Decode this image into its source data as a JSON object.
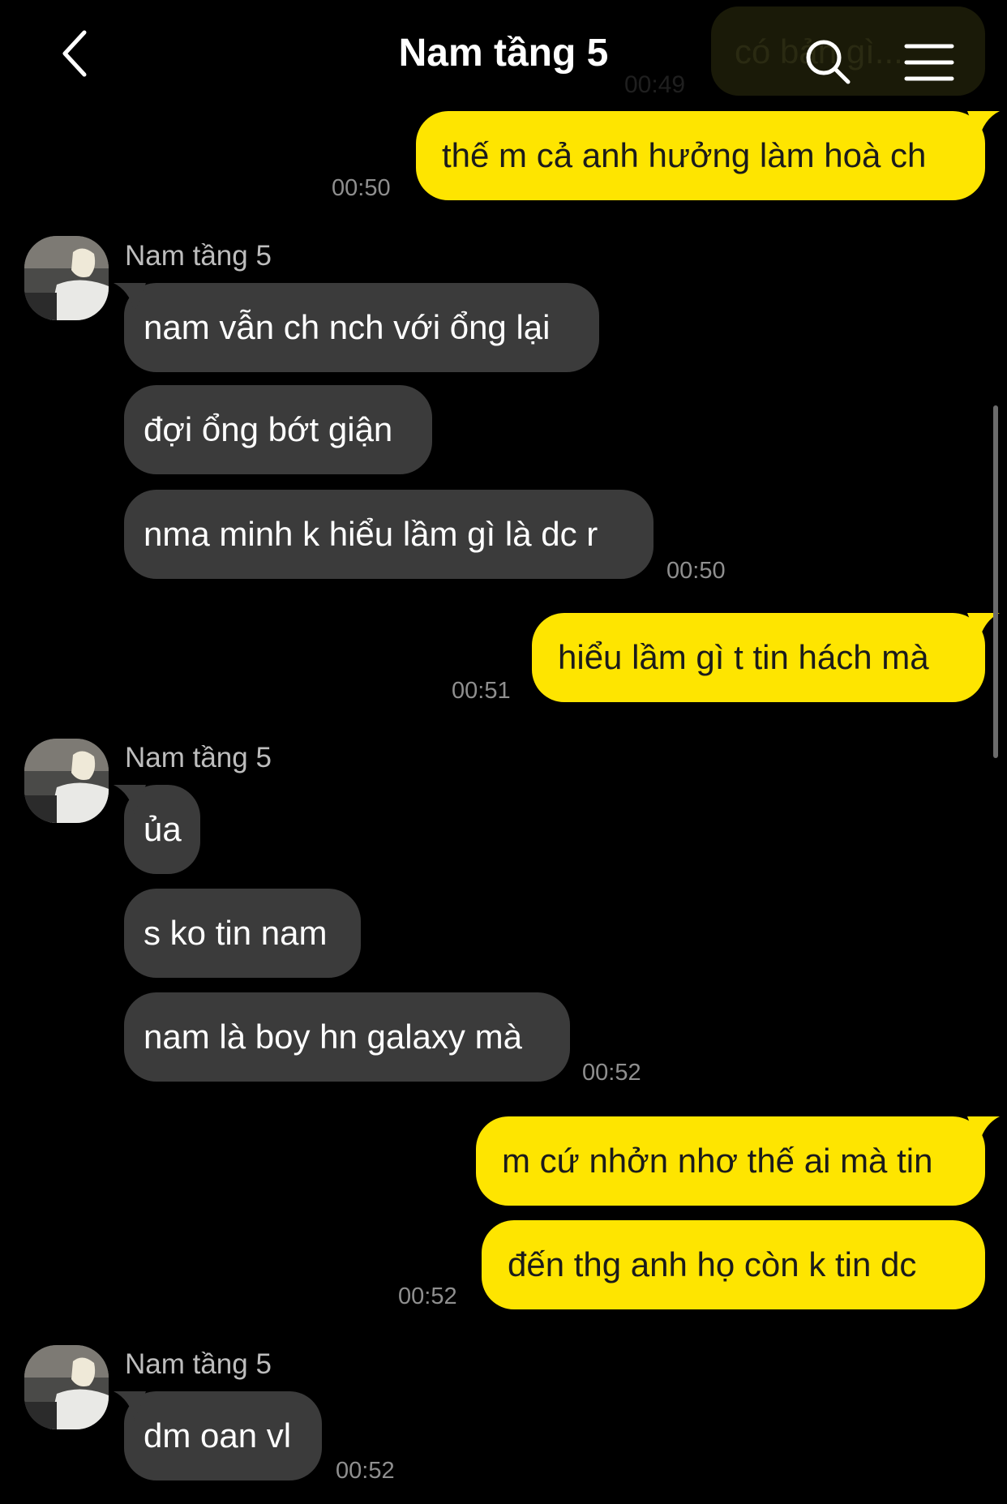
{
  "header": {
    "title": "Nam tầng 5"
  },
  "ghost_message": {
    "text": "có bản gì...",
    "time": "00:49"
  },
  "messages": [
    {
      "side": "me",
      "text": "thế m cả anh hưởng làm hoà ch",
      "time": "00:50"
    },
    {
      "side": "them",
      "sender": "Nam tầng 5",
      "text": "nam vẫn ch nch với ổng lại"
    },
    {
      "side": "them",
      "text": "đợi ổng bớt giận"
    },
    {
      "side": "them",
      "text": "nma minh k hiểu lầm gì là dc r",
      "time": "00:50"
    },
    {
      "side": "me",
      "text": "hiểu lầm gì t tin hách mà",
      "time": "00:51"
    },
    {
      "side": "them",
      "sender": "Nam tầng 5",
      "text": "ủa"
    },
    {
      "side": "them",
      "text": "s ko tin nam"
    },
    {
      "side": "them",
      "text": "nam là boy hn galaxy mà",
      "time": "00:52"
    },
    {
      "side": "me",
      "text": "m cứ nhởn nhơ thế ai mà tin"
    },
    {
      "side": "me",
      "text": "đến thg anh họ còn k tin dc",
      "time": "00:52"
    },
    {
      "side": "them",
      "sender": "Nam tầng 5",
      "text": "dm oan vl",
      "time": "00:52"
    }
  ],
  "colors": {
    "me_bubble": "#FEE500",
    "them_bubble": "#3b3b3b",
    "background": "#000000"
  },
  "icons": [
    "back-chevron-icon",
    "search-icon",
    "menu-icon"
  ]
}
